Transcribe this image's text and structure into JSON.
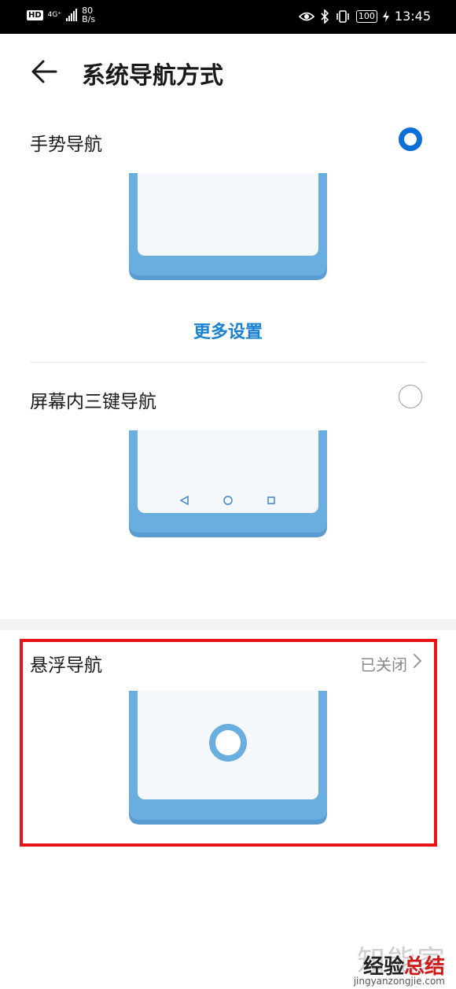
{
  "status_bar": {
    "hd": "HD",
    "network": "4G⁺",
    "speed_top": "80",
    "speed_bottom": "B/s",
    "battery": "100",
    "time": "13:45"
  },
  "header": {
    "title": "系统导航方式"
  },
  "options": {
    "gesture": {
      "label": "手势导航",
      "selected": true,
      "more_settings": "更多设置"
    },
    "three_key": {
      "label": "屏幕内三键导航",
      "selected": false
    },
    "floating": {
      "label": "悬浮导航",
      "status": "已关闭"
    }
  },
  "watermark": {
    "line1": "知能家",
    "brand_a": "经验",
    "brand_b": "总结",
    "url": "jingyanzongjie.com"
  },
  "colors": {
    "accent": "#0a6fd6",
    "link": "#1b82d1",
    "phone_frame": "#6aaee0",
    "highlight": "#e8141a"
  }
}
